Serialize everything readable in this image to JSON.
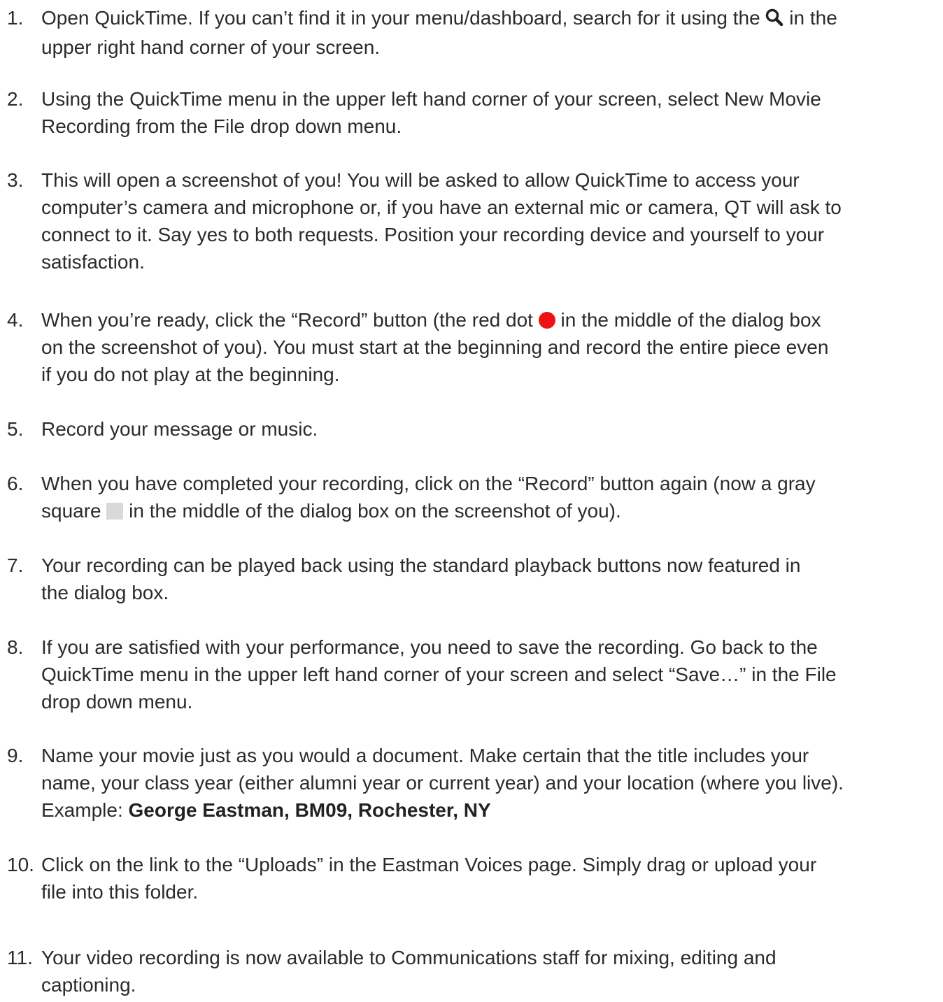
{
  "steps": [
    {
      "num": "1.",
      "lines": [
        {
          "pre": "Open QuickTime. If you can’t find it in your menu/dashboard, search for it using the ",
          "post": " in the"
        },
        {
          "text": "upper right hand corner of your screen."
        }
      ]
    },
    {
      "num": "2.",
      "lines": [
        {
          "text": "Using the QuickTime menu in the upper left hand corner of your screen, select New Movie"
        },
        {
          "text": "Recording from the File drop down menu."
        }
      ]
    },
    {
      "num": "3.",
      "lines": [
        {
          "text": "This will open a screenshot of you! You will be asked to allow QuickTime to access your"
        },
        {
          "text": "computer’s camera and microphone or, if you have an external mic or camera, QT will ask to"
        },
        {
          "text": "connect to it. Say yes to both requests. Position your recording device and yourself to your"
        },
        {
          "text": "satisfaction."
        }
      ]
    },
    {
      "num": "4.",
      "lines": [
        {
          "pre": "When you’re ready, click the “Record” button (the red dot ",
          "post": " in the middle of the dialog box"
        },
        {
          "text": "on the screenshot of you). You must start at the beginning and record the entire piece even"
        },
        {
          "text": "if you do not play at the beginning."
        }
      ]
    },
    {
      "num": "5.",
      "lines": [
        {
          "text": "Record your message or music."
        }
      ]
    },
    {
      "num": "6.",
      "lines": [
        {
          "text": "When you have completed your recording, click on the “Record” button again (now a gray"
        },
        {
          "pre": "square ",
          "post": " in the middle of the dialog box on the screenshot of you)."
        }
      ]
    },
    {
      "num": "7.",
      "lines": [
        {
          "text": "Your recording can be played back using the standard playback buttons now featured in"
        },
        {
          "text": "the dialog box."
        }
      ]
    },
    {
      "num": "8.",
      "lines": [
        {
          "text": "If you are satisfied with your performance, you need to save the recording. Go back to the"
        },
        {
          "text": "QuickTime menu in the upper left hand corner of your screen and select “Save…” in the File"
        },
        {
          "text": "drop down menu."
        }
      ]
    },
    {
      "num": "9.",
      "lines": [
        {
          "text": "Name your movie just as you would a document. Make certain that the title includes your"
        },
        {
          "text": "name, your class year (either alumni year or current year) and your location (where you live)."
        },
        {
          "pre": "Example: ",
          "bold": "George Eastman, BM09, Rochester, NY"
        }
      ]
    },
    {
      "num": "10.",
      "lines": [
        {
          "text": "Click on the link to the “Uploads” in the Eastman Voices page. Simply drag or upload your"
        },
        {
          "text": "file into this folder."
        }
      ]
    },
    {
      "num": "11.",
      "lines": [
        {
          "text": "Your video recording is now available to Communications staff for mixing, editing and"
        },
        {
          "text": "captioning."
        }
      ]
    }
  ],
  "icons": {
    "search": "search-icon",
    "record": "red-dot-icon",
    "stop": "gray-square-icon"
  },
  "colors": {
    "text": "#2b2b2b",
    "record_dot": "#ee1111",
    "stop_square": "#d9d9d9"
  }
}
